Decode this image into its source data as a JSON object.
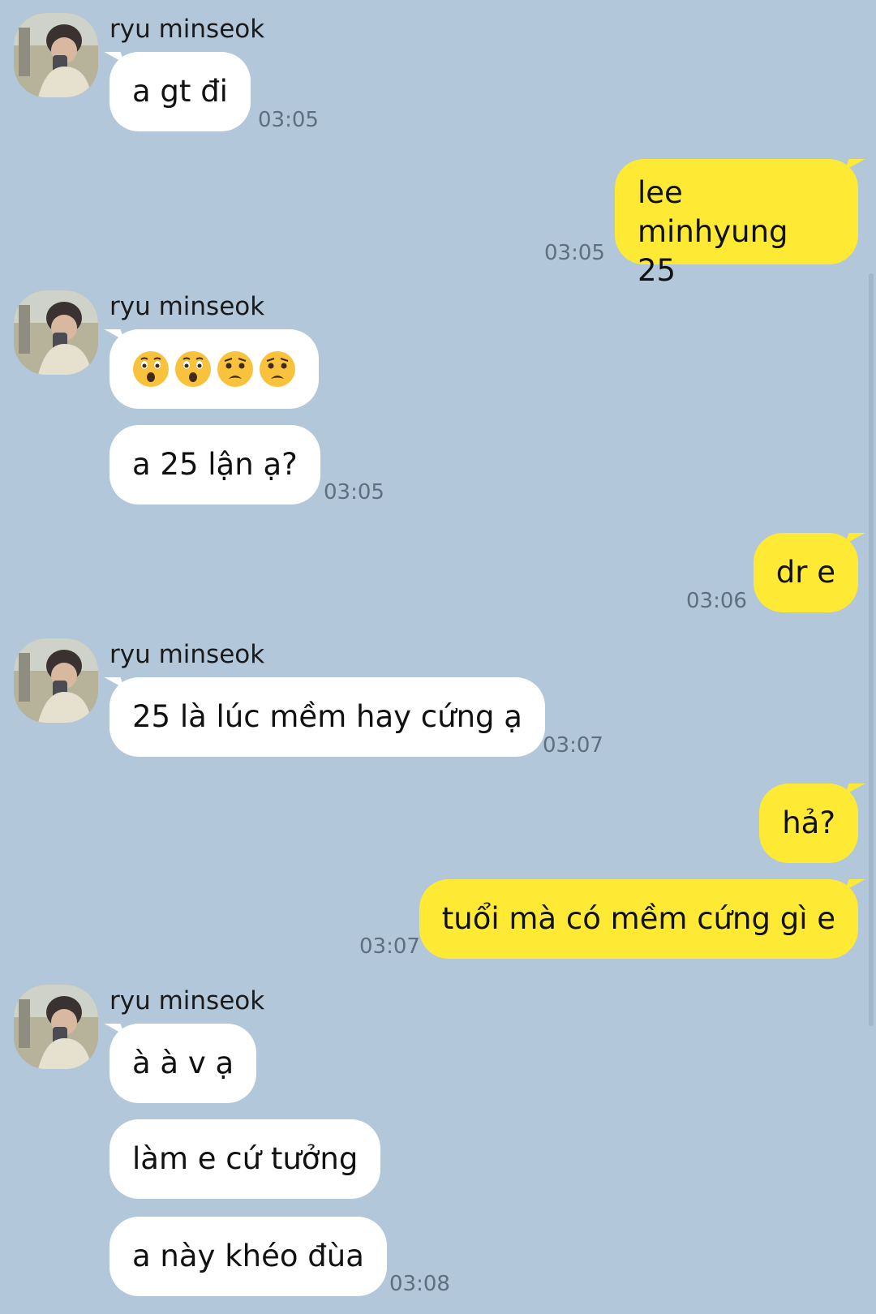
{
  "contact": {
    "name": "ryu minseok"
  },
  "messages": [
    {
      "sender": "ryu minseok",
      "direction": "in",
      "text": "a gt đi",
      "time": "03:05"
    },
    {
      "direction": "out",
      "text": "lee minhyung 25",
      "time": "03:05"
    },
    {
      "sender": "ryu minseok",
      "direction": "in",
      "text": "😲😲😧😧",
      "emoji": [
        "astonished-face",
        "astonished-face",
        "anguished-face",
        "anguished-face"
      ]
    },
    {
      "direction": "in",
      "text": "a 25 lận ạ?",
      "time": "03:05"
    },
    {
      "direction": "out",
      "text": "dr e",
      "time": "03:06"
    },
    {
      "sender": "ryu minseok",
      "direction": "in",
      "text": "25 là lúc mềm hay cứng ạ",
      "time": "03:07"
    },
    {
      "direction": "out",
      "text": "hả?"
    },
    {
      "direction": "out",
      "text": "tuổi mà có mềm cứng gì e",
      "time": "03:07"
    },
    {
      "sender": "ryu minseok",
      "direction": "in",
      "text": "à à v ạ"
    },
    {
      "direction": "in",
      "text": "làm e cứ tưởng"
    },
    {
      "direction": "in",
      "text": "a này khéo đùa",
      "time": "03:08"
    }
  ],
  "colors": {
    "background": "#b2c7d9",
    "incoming_bubble": "#ffffff",
    "outgoing_bubble": "#fee934",
    "timestamp": "#5f6f80"
  }
}
